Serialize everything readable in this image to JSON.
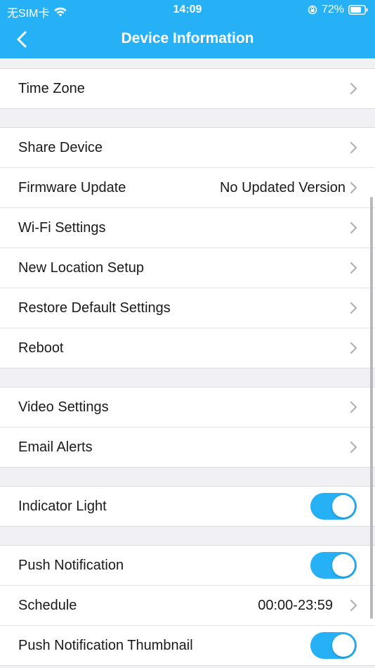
{
  "status_bar": {
    "carrier": "无SIM卡",
    "time": "14:09",
    "battery": "72%"
  },
  "nav": {
    "title": "Device Information"
  },
  "groups": [
    {
      "rows": [
        {
          "label": "Time Zone",
          "type": "chevron"
        }
      ]
    },
    {
      "rows": [
        {
          "label": "Share Device",
          "type": "chevron"
        },
        {
          "label": "Firmware Update",
          "value": "No Updated Version",
          "type": "chevron"
        },
        {
          "label": "Wi-Fi Settings",
          "type": "chevron"
        },
        {
          "label": "New Location Setup",
          "type": "chevron"
        },
        {
          "label": "Restore Default Settings",
          "type": "chevron"
        },
        {
          "label": "Reboot",
          "type": "chevron"
        }
      ]
    },
    {
      "rows": [
        {
          "label": "Video Settings",
          "type": "chevron"
        },
        {
          "label": "Email Alerts",
          "type": "chevron"
        }
      ]
    },
    {
      "rows": [
        {
          "label": "Indicator Light",
          "type": "toggle",
          "on": true
        }
      ]
    },
    {
      "rows": [
        {
          "label": "Push Notification",
          "type": "toggle",
          "on": true
        },
        {
          "label": "Schedule",
          "value": "00:00-23:59",
          "type": "chevron"
        },
        {
          "label": "Push Notification Thumbnail",
          "type": "toggle",
          "on": true
        }
      ]
    }
  ],
  "colors": {
    "accent": "#26b1f6",
    "background": "#f0f0f5"
  }
}
